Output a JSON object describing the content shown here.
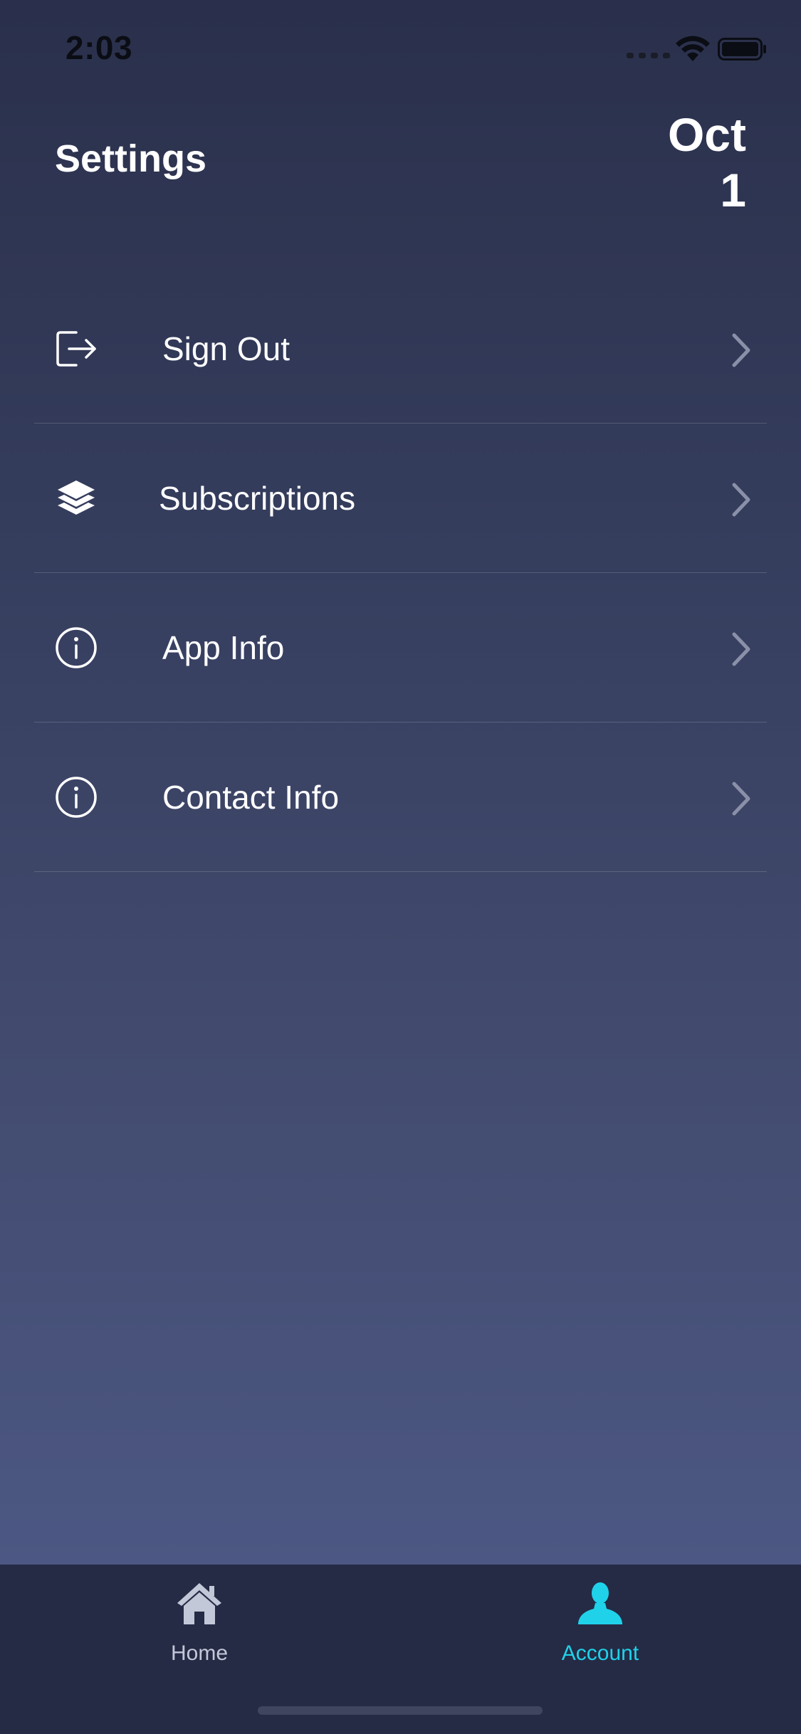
{
  "status_bar": {
    "time": "2:03"
  },
  "header": {
    "title": "Settings",
    "date_month": "Oct",
    "date_day": "1"
  },
  "menu": {
    "items": [
      {
        "label": "Sign Out",
        "icon": "sign-out-icon"
      },
      {
        "label": "Subscriptions",
        "icon": "layers-icon"
      },
      {
        "label": "App Info",
        "icon": "info-icon"
      },
      {
        "label": "Contact Info",
        "icon": "info-icon"
      }
    ]
  },
  "tab_bar": {
    "home_label": "Home",
    "account_label": "Account",
    "active_tab": "Account",
    "active_color": "#1fd2ea",
    "inactive_color": "#c3c8d8"
  },
  "colors": {
    "background_top": "#2a304b",
    "background_bottom": "#4f5b8a",
    "tab_bar": "#252b45"
  }
}
